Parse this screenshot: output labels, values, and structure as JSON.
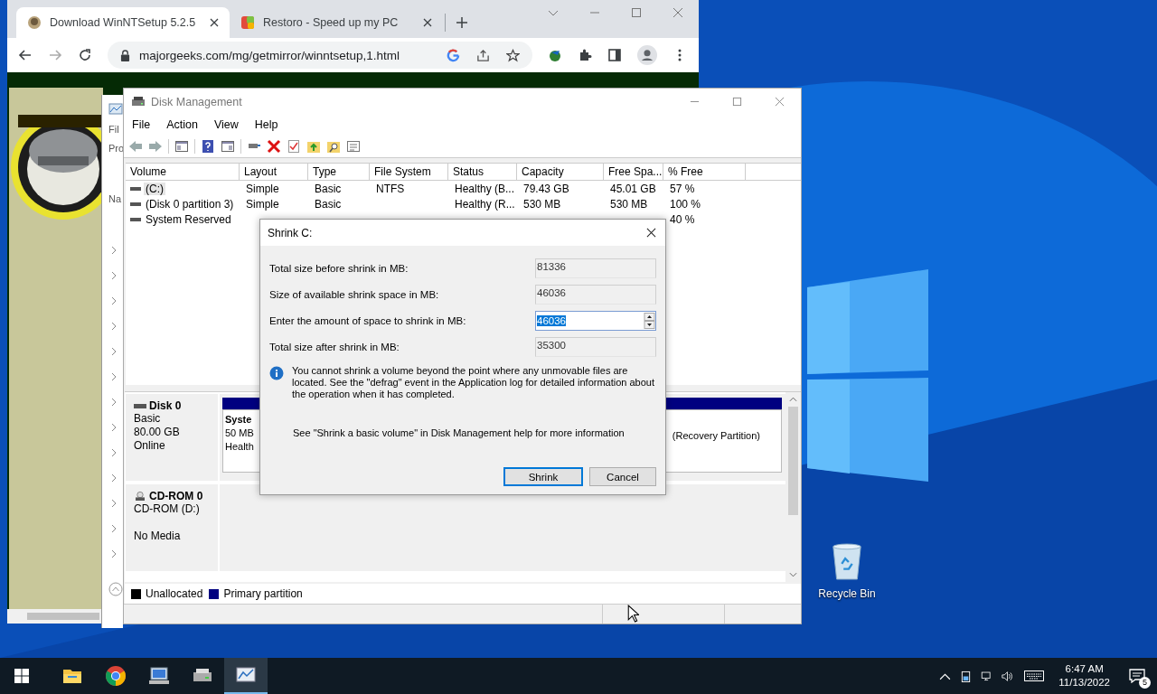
{
  "browser": {
    "tabs": [
      {
        "title": "Download WinNTSetup 5.2.5",
        "selected": true
      },
      {
        "title": "Restoro - Speed up my PC",
        "selected": false
      }
    ],
    "url": "majorgeeks.com/mg/getmirror/winntsetup,1.html"
  },
  "back_window": {
    "labels": [
      "Fil",
      "Pro",
      "Na"
    ]
  },
  "disk_management": {
    "title": "Disk Management",
    "menu": [
      "File",
      "Action",
      "View",
      "Help"
    ],
    "columns": [
      "Volume",
      "Layout",
      "Type",
      "File System",
      "Status",
      "Capacity",
      "Free Spa...",
      "% Free"
    ],
    "rows": [
      {
        "volume": "(C:)",
        "layout": "Simple",
        "type": "Basic",
        "file_system": "NTFS",
        "status": "Healthy (B...",
        "capacity": "79.43 GB",
        "free_space": "45.01 GB",
        "percent_free": "57 %",
        "selected": true
      },
      {
        "volume": "(Disk 0 partition 3)",
        "layout": "Simple",
        "type": "Basic",
        "status": "Healthy (R...",
        "capacity": "530 MB",
        "free_space": "530 MB",
        "percent_free": "100 %",
        "selected": false
      },
      {
        "volume": "System Reserved",
        "percent_free": "40 %",
        "selected": false
      }
    ],
    "disks": [
      {
        "kind": "disk",
        "name": "Disk 0",
        "lines": [
          "Basic",
          "80.00 GB",
          "Online"
        ],
        "partitions": [
          {
            "lines": [
              "Syste",
              "50 MB",
              "Health"
            ]
          },
          {
            "lines": [
              "(Recovery Partition)"
            ]
          }
        ]
      },
      {
        "kind": "cdrom",
        "name": "CD-ROM 0",
        "lines": [
          "CD-ROM (D:)",
          "No Media"
        ]
      }
    ],
    "legend": [
      {
        "label": "Unallocated",
        "color": "#000000"
      },
      {
        "label": "Primary partition",
        "color": "#000080"
      }
    ]
  },
  "dialog": {
    "title": "Shrink C:",
    "fields": [
      {
        "label": "Total size before shrink in MB:",
        "value": "81336",
        "kind": "readonly"
      },
      {
        "label": "Size of available shrink space in MB:",
        "value": "46036",
        "kind": "readonly"
      },
      {
        "label": "Enter the amount of space to shrink in MB:",
        "value": "46036",
        "kind": "spin",
        "text_selected": true
      },
      {
        "label": "Total size after shrink in MB:",
        "value": "35300",
        "kind": "readonly"
      }
    ],
    "info": "You cannot shrink a volume beyond the point where any unmovable files are located. See the \"defrag\" event in the Application log for detailed information about the operation when it has completed.",
    "help": "See \"Shrink a basic volume\" in Disk Management help for more information",
    "buttons": [
      {
        "label": "Shrink",
        "default": true
      },
      {
        "label": "Cancel",
        "default": false
      }
    ]
  },
  "desktop": {
    "icons": [
      {
        "label": "Recycle Bin"
      }
    ]
  },
  "taskbar": {
    "apps": [
      {
        "kind": "explorer",
        "active": false
      },
      {
        "kind": "chrome",
        "active": false
      },
      {
        "kind": "computer",
        "active": false
      },
      {
        "kind": "drive",
        "active": false
      },
      {
        "kind": "diskmgmt",
        "active": true
      }
    ],
    "time": "6:47 AM",
    "date": "11/13/2022",
    "notifications": "5"
  }
}
